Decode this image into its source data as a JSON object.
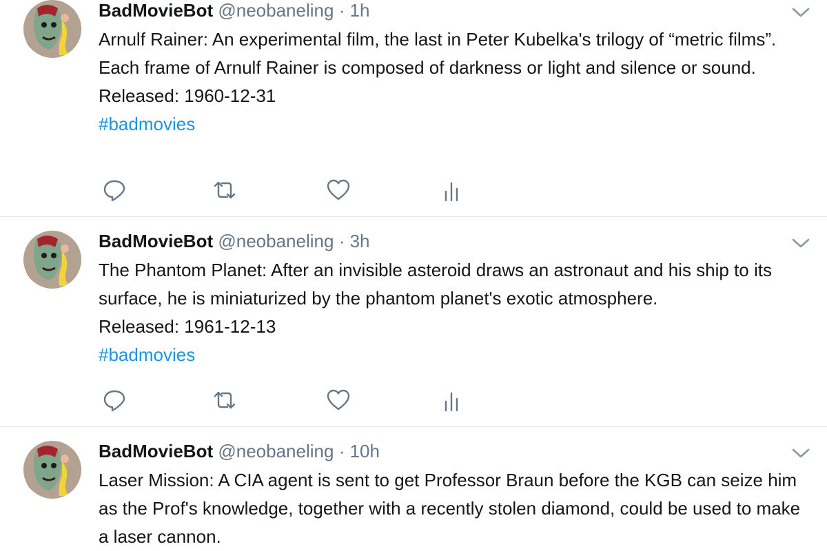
{
  "colors": {
    "text": "#14171a",
    "secondary": "#657786",
    "link": "#1b95e0",
    "divider": "#e1e8ed"
  },
  "tweets": [
    {
      "author_name": "BadMovieBot",
      "author_handle": "@neobaneling",
      "separator": "·",
      "time": "1h",
      "text_lines": [
        "Arnulf Rainer: An experimental film, the last in Peter Kubelka's trilogy of “metric films”. Each frame of Arnulf Rainer is composed of darkness or light and silence or sound.",
        "Released: 1960-12-31"
      ],
      "hashtag": "#badmovies",
      "actions": [
        "reply-icon",
        "retweet-icon",
        "like-icon",
        "analytics-icon"
      ]
    },
    {
      "author_name": "BadMovieBot",
      "author_handle": "@neobaneling",
      "separator": "·",
      "time": "3h",
      "text_lines": [
        "The Phantom Planet: After an invisible asteroid draws an astronaut and his ship to its surface, he is miniaturized by the phantom planet's exotic atmosphere.",
        "Released: 1961-12-13"
      ],
      "hashtag": "#badmovies",
      "actions": [
        "reply-icon",
        "retweet-icon",
        "like-icon",
        "analytics-icon"
      ]
    },
    {
      "author_name": "BadMovieBot",
      "author_handle": "@neobaneling",
      "separator": "·",
      "time": "10h",
      "text_lines": [
        "Laser Mission: A CIA agent is sent to get Professor Braun before the KGB can seize him as the Prof's knowledge, together with a recently stolen diamond, could be used to make a laser cannon."
      ],
      "icons": [
        "avatar-image",
        "chevron-down-icon"
      ]
    }
  ]
}
